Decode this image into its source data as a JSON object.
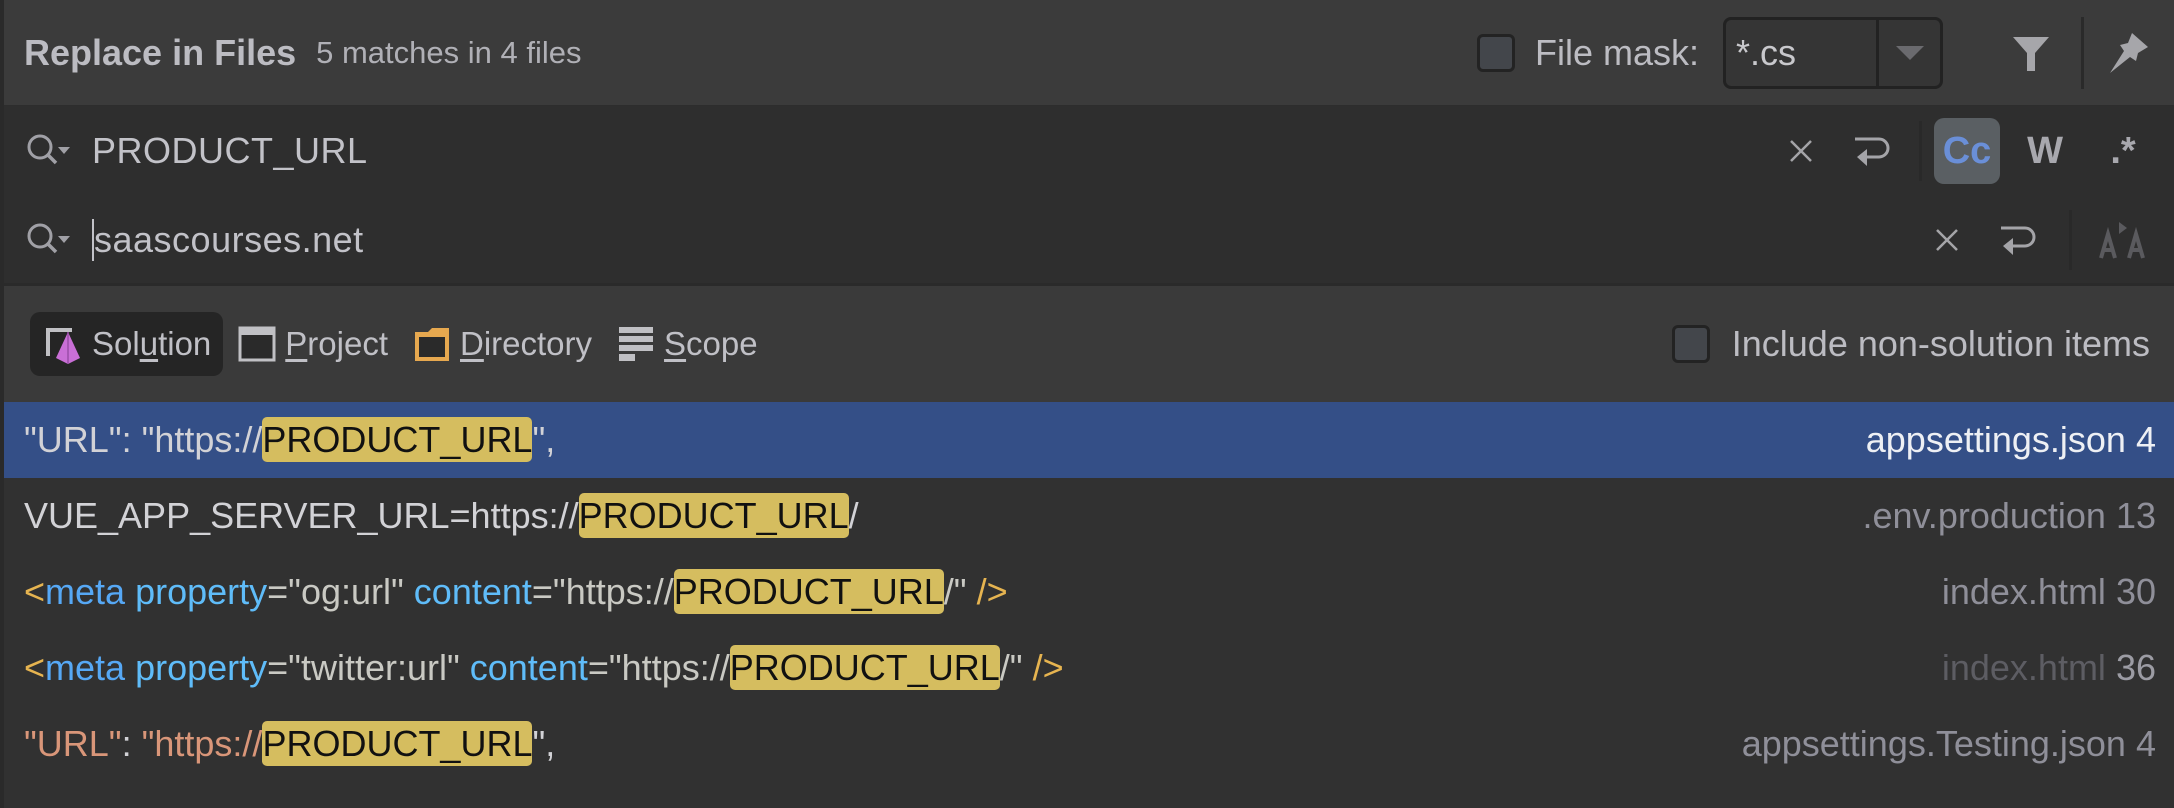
{
  "header": {
    "title": "Replace in Files",
    "summary": "5 matches in 4 files",
    "file_mask_checked": false,
    "file_mask_label": "File mask:",
    "file_mask_value": "*.cs",
    "filter_icon": "filter-icon",
    "pin_icon": "pin-icon"
  },
  "find": {
    "value": "PRODUCT_URL",
    "icon": "search-history-icon",
    "clear_icon": "close-icon",
    "newline_icon": "new-line-icon",
    "options": [
      {
        "label": "Cc",
        "name": "match-case",
        "active": true
      },
      {
        "label": "W",
        "name": "words",
        "active": false
      },
      {
        "label": ".*",
        "name": "regex",
        "active": false
      }
    ]
  },
  "replace": {
    "value": "saascourses.net",
    "icon": "search-history-icon",
    "clear_icon": "close-icon",
    "newline_icon": "new-line-icon",
    "preserve_case_icon": "preserve-case-icon"
  },
  "scope": {
    "tabs": [
      {
        "pre": "Sol",
        "u": "u",
        "post": "tion",
        "icon": "solution-icon",
        "active": true
      },
      {
        "pre": "",
        "u": "P",
        "post": "roject",
        "icon": "project-icon",
        "active": false
      },
      {
        "pre": "",
        "u": "D",
        "post": "irectory",
        "icon": "directory-icon",
        "active": false
      },
      {
        "pre": "",
        "u": "S",
        "post": "cope",
        "icon": "scope-icon",
        "active": false
      }
    ],
    "include_non_solution_checked": false,
    "include_non_solution_label": "Include non-solution items"
  },
  "results": [
    {
      "selected": true,
      "segments": [
        {
          "t": "\"URL\": \"https://",
          "c": "t-punct"
        },
        {
          "t": "PRODUCT_URL",
          "c": "hl"
        },
        {
          "t": "\",",
          "c": "t-punct"
        }
      ],
      "file": "appsettings.json",
      "file_dim": false,
      "line": "4"
    },
    {
      "selected": false,
      "segments": [
        {
          "t": "VUE_APP_SERVER_URL=https://",
          "c": "t-punct"
        },
        {
          "t": "PRODUCT_URL",
          "c": "hl"
        },
        {
          "t": "/",
          "c": "t-punct"
        }
      ],
      "file": ".env.production",
      "file_dim": false,
      "line": "13"
    },
    {
      "selected": false,
      "segments": [
        {
          "t": "<",
          "c": "t-tag"
        },
        {
          "t": "meta ",
          "c": "t-name"
        },
        {
          "t": "property",
          "c": "t-attr"
        },
        {
          "t": "=\"og:url\" ",
          "c": "t-val"
        },
        {
          "t": "content",
          "c": "t-attr"
        },
        {
          "t": "=\"https://",
          "c": "t-val"
        },
        {
          "t": "PRODUCT_URL",
          "c": "hl"
        },
        {
          "t": "/\" ",
          "c": "t-val"
        },
        {
          "t": "/>",
          "c": "t-tag"
        }
      ],
      "file": "index.html",
      "file_dim": false,
      "line": "30"
    },
    {
      "selected": false,
      "segments": [
        {
          "t": "<",
          "c": "t-tag"
        },
        {
          "t": "meta ",
          "c": "t-name"
        },
        {
          "t": "property",
          "c": "t-attr"
        },
        {
          "t": "=\"twitter:url\" ",
          "c": "t-val"
        },
        {
          "t": "content",
          "c": "t-attr"
        },
        {
          "t": "=\"https://",
          "c": "t-val"
        },
        {
          "t": "PRODUCT_URL",
          "c": "hl"
        },
        {
          "t": "/\" ",
          "c": "t-val"
        },
        {
          "t": "/>",
          "c": "t-tag"
        }
      ],
      "file": "index.html",
      "file_dim": true,
      "line": "36"
    },
    {
      "selected": false,
      "segments": [
        {
          "t": "\"URL\"",
          "c": "t-str"
        },
        {
          "t": ": ",
          "c": "t-punct"
        },
        {
          "t": "\"https://",
          "c": "t-str"
        },
        {
          "t": "PRODUCT_URL",
          "c": "hl"
        },
        {
          "t": "\",",
          "c": "t-punct"
        }
      ],
      "file": "appsettings.Testing.json",
      "file_dim": false,
      "line": "4"
    }
  ],
  "colors": {
    "selection": "#344f87",
    "highlight": "#d5bd5f",
    "active_option": "#6a8fd8",
    "solution_icon": "#c96fd6",
    "directory_icon": "#e6a84f"
  }
}
